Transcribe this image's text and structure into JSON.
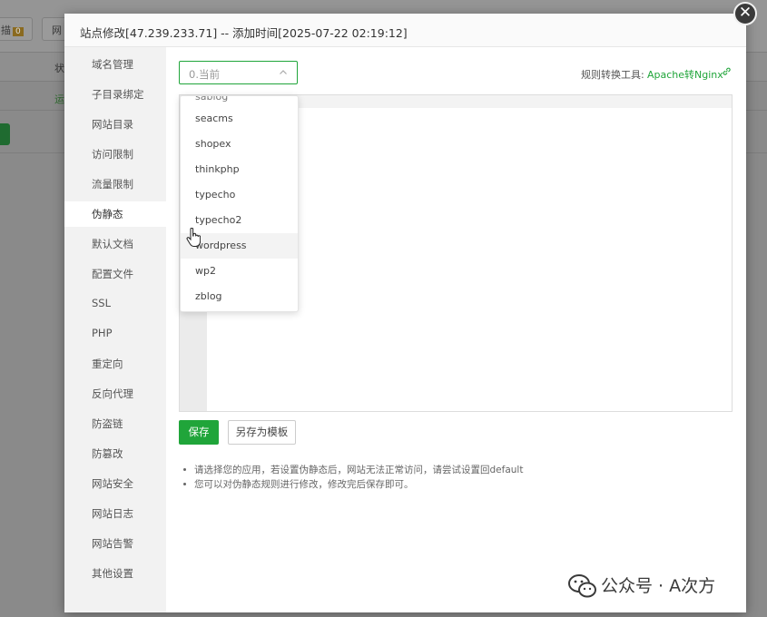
{
  "background": {
    "button1_label": "描",
    "button1_badge": "0",
    "button2_label": "网",
    "column_label": "状",
    "status_text": "运"
  },
  "dialog": {
    "title": "站点修改[47.239.233.71] -- 添加时间[2025-07-22 02:19:12]",
    "close_icon": "✕"
  },
  "sidebar": {
    "items": [
      {
        "label": "域名管理"
      },
      {
        "label": "子目录绑定"
      },
      {
        "label": "网站目录"
      },
      {
        "label": "访问限制"
      },
      {
        "label": "流量限制"
      },
      {
        "label": "伪静态"
      },
      {
        "label": "默认文档"
      },
      {
        "label": "配置文件"
      },
      {
        "label": "SSL"
      },
      {
        "label": "PHP"
      },
      {
        "label": "重定向"
      },
      {
        "label": "反向代理"
      },
      {
        "label": "防盗链"
      },
      {
        "label": "防篡改"
      },
      {
        "label": "网站安全"
      },
      {
        "label": "网站日志"
      },
      {
        "label": "网站告警"
      },
      {
        "label": "其他设置"
      }
    ],
    "active": "伪静态"
  },
  "rewrite": {
    "select_value": "0.当前",
    "tool_label": "规则转换工具:",
    "tool_link": "Apache转Nginx",
    "dropdown_options": [
      "sablog",
      "seacms",
      "shopex",
      "thinkphp",
      "typecho",
      "typecho2",
      "wordpress",
      "wp2",
      "zblog"
    ],
    "hovered_option": "wordpress",
    "save_label": "保存",
    "save_template_label": "另存为模板",
    "tips": [
      "请选择您的应用，若设置伪静态后，网站无法正常访问，请尝试设置回default",
      "您可以对伪静态规则进行修改，修改完后保存即可。"
    ]
  },
  "watermark": {
    "text": "公众号 · A次方"
  },
  "colors": {
    "accent": "#20a53a",
    "overlay": "#8a8a8a",
    "sidebar_bg": "#f2f2f2"
  }
}
